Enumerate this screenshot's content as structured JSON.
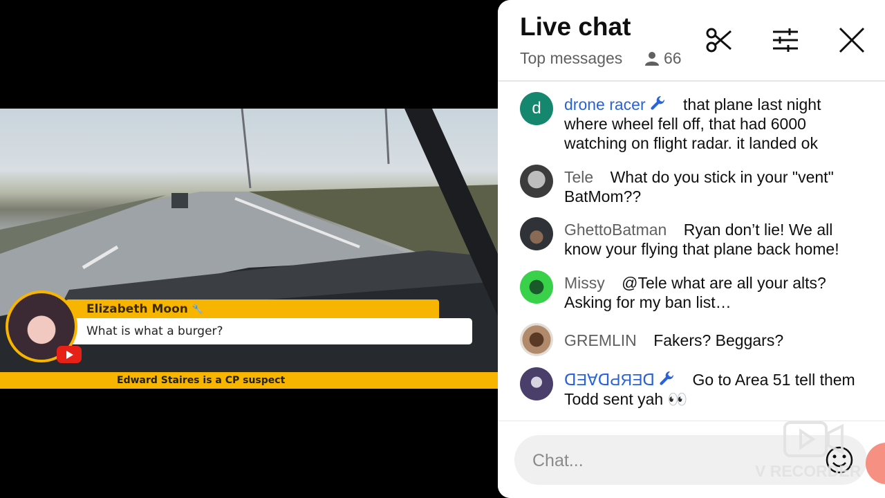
{
  "video": {
    "chat_banner": {
      "author": "Elizabeth Moon",
      "message": "What is what a burger?"
    },
    "lower_third": "Edward Staires is a CP suspect"
  },
  "chat": {
    "title": "Live chat",
    "mode": "Top messages",
    "viewers": "66",
    "placeholder": "Chat...",
    "messages": [
      {
        "author": "drone racer",
        "avatar_letter": "d",
        "moderator": true,
        "text": "that plane last night where wheel fell off, that had 6000 watching on flight radar. it landed ok"
      },
      {
        "author": "Tele",
        "moderator": false,
        "text": "What do you stick in your \"vent\" BatMom??"
      },
      {
        "author": "GhettoBatman",
        "moderator": false,
        "text": "Ryan don’t lie! We all know your flying that plane back home!"
      },
      {
        "author": "Missy",
        "moderator": false,
        "text": "@Tele what are all your alts? Asking for my ban list…"
      },
      {
        "author": "GREMLIN",
        "moderator": false,
        "text": "Fakers? Beggars?"
      },
      {
        "author": "ᗡƎⱯᗡԀЯƎᗡ",
        "moderator": true,
        "text": "Go to Area 51 tell them Todd sent yah 👀"
      }
    ]
  },
  "watermark": "V RECORDER",
  "colors": {
    "banner_yellow": "#f7b500",
    "owner_blue": "#2962d9",
    "youtube_red": "#e62117"
  },
  "icons": [
    "scissors-icon",
    "sliders-icon",
    "close-icon",
    "person-icon",
    "wrench-icon",
    "emoji-icon",
    "youtube-icon",
    "camera-icon"
  ]
}
